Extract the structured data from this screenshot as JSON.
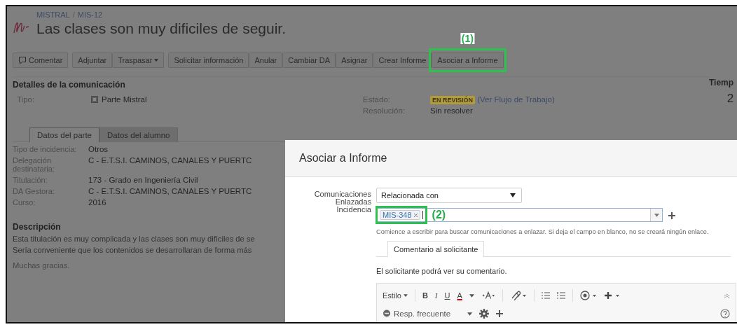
{
  "breadcrumbs": [
    {
      "label": "MISTRAL"
    },
    {
      "label": "MIS-12"
    }
  ],
  "breadcrumb_separator": "/",
  "issue": {
    "title": "Las clases son muy dificiles de seguir."
  },
  "toolbar": [
    [
      {
        "label": "Comentar",
        "kind": "comment",
        "dropdown": false
      }
    ],
    [
      {
        "label": "Adjuntar",
        "kind": "plain",
        "dropdown": false
      },
      {
        "label": "Traspasar",
        "kind": "plain",
        "dropdown": true
      }
    ],
    [
      {
        "label": "Solicitar información",
        "kind": "plain",
        "dropdown": false
      },
      {
        "label": "Anular",
        "kind": "plain",
        "dropdown": false
      },
      {
        "label": "Cambiar DA",
        "kind": "plain",
        "dropdown": false
      },
      {
        "label": "Asignar",
        "kind": "plain",
        "dropdown": false
      },
      {
        "label": "Crear Informe",
        "kind": "plain",
        "dropdown": false
      },
      {
        "label": "Asociar a Informe",
        "kind": "plain",
        "dropdown": false,
        "annotation": "(1)"
      }
    ]
  ],
  "details": {
    "heading": "Detalles de la comunicación",
    "type_label": "Tipo:",
    "type_value": "Parte Mistral",
    "status_label": "Estado:",
    "status_badge": "EN REVISIÓN",
    "status_link": "(Ver Flujo de Trabajo)",
    "resolution_label": "Resolución:",
    "resolution_value": "Sin resolver"
  },
  "side": {
    "heading": "Tiemp",
    "value": "2"
  },
  "tabs": [
    {
      "label": "Datos del parte",
      "selected": true
    },
    {
      "label": "Datos del alumno",
      "selected": false
    }
  ],
  "fields": [
    {
      "label": "Tipo de incidencia:",
      "value": "Otros"
    },
    {
      "label": "Delegación destinataria:",
      "value": "C - E.T.S.I. CAMINOS, CANALES Y PUERTC"
    },
    {
      "label": "Titulación:",
      "value": "173 - Grado en Ingeniería Civil"
    },
    {
      "label": "DA Gestora:",
      "value": "C - E.T.S.I. CAMINOS, CANALES Y PUERTC"
    },
    {
      "label": "Curso:",
      "value": "2016"
    }
  ],
  "description": {
    "heading": "Descripción",
    "lines": [
      "Esta titulación es muy complicada y las clases son muy difíciles de se",
      "Sería conveniente que los contenidos se desarrollaran de forma más"
    ],
    "closing": "Muchas gracias."
  },
  "dialog": {
    "title": "Asociar a Informe",
    "link_label": "Comunicaciones Enlazadas",
    "link_type": "Relacionada con",
    "issue_label": "Incidencia",
    "tags": [
      {
        "label": "MIS-348",
        "annotation": "(2)"
      }
    ],
    "hint": "Comience a escribir para buscar comunicaciones a enlazar. Si deja el campo en blanco, no se creará ningún enlace.",
    "tabs": [
      {
        "label": "Comentario al solicitante",
        "selected": true
      }
    ],
    "note": "El solicitante podrá ver su comentario.",
    "editor": {
      "style": "Estilo",
      "bold": "B",
      "italic": "I",
      "underline": "U",
      "font_color": "A",
      "quick": "Resp. frecuente"
    }
  }
}
